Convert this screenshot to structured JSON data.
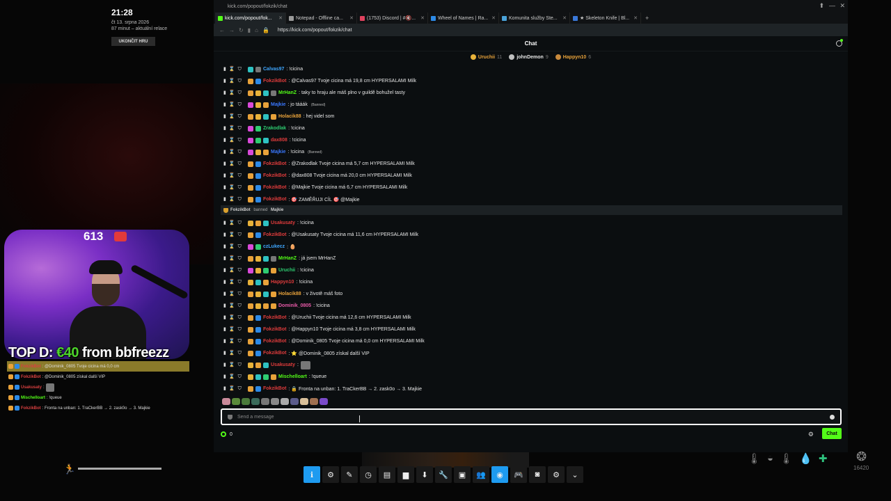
{
  "overlay": {
    "clock": "21:28",
    "date": "čt 13. srpna 2026",
    "session": "87 minut – aktuální relace",
    "end_button": "UKONČIT HRU",
    "sub_count": "613",
    "top_donation_prefix": "TOP D: ",
    "top_donation_amount": "€40",
    "top_donation_suffix": " from bbfreezz",
    "chat": [
      {
        "user": "FokzikBot",
        "text": ": @Dominik_0805 Tvoje cicina má 0,0 cm",
        "color": "#d94040",
        "highlight": true
      },
      {
        "user": "FokzikBot",
        "text": ": @Dominik_0805 získal další VIP",
        "color": "#d94040",
        "highlight": false
      },
      {
        "user": "Usakusaty",
        "text": ":",
        "color": "#d94040",
        "highlight": false
      },
      {
        "user": "Mischelloart",
        "text": ": !queue",
        "color": "#53fc18",
        "highlight": false
      },
      {
        "user": "FokzikBot",
        "text": ": Fronta na unban: 1. TraCkerBB → 2. zask0o → 3. Majkie",
        "color": "#d94040",
        "highlight": false
      }
    ],
    "progress": 1.0
  },
  "browser": {
    "title": "kick.com/popout/fokzik/chat",
    "tabs": [
      {
        "label": "kick.com/popout/fok...",
        "color": "#53fc18",
        "active": true
      },
      {
        "label": "Notepad - Offline ca...",
        "color": "#9a9a9a",
        "active": false
      },
      {
        "label": "(1753) Discord | #🔇...",
        "color": "#e0425e",
        "active": false
      },
      {
        "label": "Wheel of Names | Ra...",
        "color": "#2d8ae6",
        "active": false
      },
      {
        "label": "Komunita služby Ste...",
        "color": "#4aa2d9",
        "active": false
      },
      {
        "label": "★ Skeleton Knife | Bl...",
        "color": "#3a78d8",
        "active": false
      }
    ],
    "new_tab": "+",
    "url": "https://kick.com/popout/fokzik/chat"
  },
  "chat": {
    "title": "Chat",
    "leaders": [
      {
        "name": "Uruchii",
        "count": "11",
        "color": "#e8a23a",
        "medal": "#e8b23a"
      },
      {
        "name": "johnDemon",
        "count": "9",
        "color": "#e6e6e6",
        "medal": "#c0c0c0"
      },
      {
        "name": "Happyn10",
        "count": "6",
        "color": "#e8a23a",
        "medal": "#c98a3c"
      }
    ],
    "notice": {
      "actor": "FokzikBot",
      "verb": " banned ",
      "target": "Majkie"
    },
    "messages_before": [
      {
        "user": "Calvas97",
        "text": ": !cicina",
        "color": "#3fa7ff",
        "badges": [
          "#2ec2c2",
          "#777"
        ]
      },
      {
        "user": "FokzikBot",
        "text": ": @Calvas97 Tvoje cicina má 19,8 cm HYPERSALAMI Milk",
        "color": "#e03c3c",
        "badges": [
          "#e8a23a",
          "#2d8ae6"
        ]
      },
      {
        "user": "MrHanZ",
        "text": ": taky to hraju ale máš plno v guildě bohužel tasty",
        "color": "#53fc18",
        "badges": [
          "#e8a23a",
          "#e8b23a",
          "#2ec2c2",
          "#777"
        ]
      },
      {
        "user": "Majkie",
        "text": ": jo tááák",
        "color": "#3a78ff",
        "badges": [
          "#d94ad9",
          "#e8b23a",
          "#e8a23a"
        ],
        "banned": true
      },
      {
        "user": "Holacik88",
        "text": ": hej videl som",
        "color": "#e8a23a",
        "badges": [
          "#e8a23a",
          "#e8b23a",
          "#2ec2c2",
          "#e8a23a"
        ]
      },
      {
        "user": "Zrakodlak",
        "text": ": !cicina",
        "color": "#2ecc71",
        "badges": [
          "#d94ad9",
          "#2ecc71"
        ]
      },
      {
        "user": "dax808",
        "text": ": !cicina",
        "color": "#e03c3c",
        "badges": [
          "#d94ad9",
          "#2ecc71",
          "#2ec2c2"
        ]
      },
      {
        "user": "Majkie",
        "text": ": !cicina",
        "color": "#3a78ff",
        "badges": [
          "#d94ad9",
          "#e8b23a",
          "#e8a23a"
        ],
        "banned": true
      },
      {
        "user": "FokzikBot",
        "text": ": @Zrakodlak Tvoje cicina má 5,7 cm HYPERSALAMI Milk",
        "color": "#e03c3c",
        "badges": [
          "#e8a23a",
          "#2d8ae6"
        ]
      },
      {
        "user": "FokzikBot",
        "text": ": @dax808 Tvoje cicina má 20,0 cm HYPERSALAMI Milk",
        "color": "#e03c3c",
        "badges": [
          "#e8a23a",
          "#2d8ae6"
        ]
      },
      {
        "user": "FokzikBot",
        "text": ": @Majkie Tvoje cicina má 6,7 cm HYPERSALAMI Milk",
        "color": "#e03c3c",
        "badges": [
          "#e8a23a",
          "#2d8ae6"
        ]
      },
      {
        "user": "FokzikBot",
        "text": ": 🎯 ZAMĚŘUJI CÍL 🎯 @Majkie",
        "color": "#e03c3c",
        "badges": [
          "#e8a23a",
          "#2d8ae6"
        ]
      }
    ],
    "messages_after": [
      {
        "user": "Usakusaty",
        "text": ": !cicina",
        "color": "#e03c3c",
        "badges": [
          "#e8b23a",
          "#e8a23a",
          "#2ec2c2"
        ]
      },
      {
        "user": "FokzikBot",
        "text": ": @Usakusaty Tvoje cicina má 11,6 cm HYPERSALAMI Milk",
        "color": "#e03c3c",
        "badges": [
          "#e8a23a",
          "#2d8ae6"
        ]
      },
      {
        "user": "czLukecz",
        "text": ": 🥚",
        "color": "#3fa7ff",
        "badges": [
          "#d94ad9",
          "#2ecc71"
        ]
      },
      {
        "user": "MrHanZ",
        "text": ": já jsem MrHanZ",
        "color": "#53fc18",
        "badges": [
          "#e8a23a",
          "#e8b23a",
          "#2ec2c2",
          "#777"
        ]
      },
      {
        "user": "Uruchii",
        "text": ": !cicina",
        "color": "#2ecc71",
        "badges": [
          "#d94ad9",
          "#e8b23a",
          "#2ecc71",
          "#e8a23a"
        ]
      },
      {
        "user": "Happyn10",
        "text": ": !cicina",
        "color": "#e03c3c",
        "badges": [
          "#e8b23a",
          "#2ec2c2",
          "#e8a23a"
        ]
      },
      {
        "user": "Holacik88",
        "text": ": v životě máš foto",
        "color": "#e8a23a",
        "badges": [
          "#e8a23a",
          "#e8b23a",
          "#2ec2c2",
          "#e8a23a"
        ]
      },
      {
        "user": "Dominik_0805",
        "text": ": !cicina",
        "color": "#e85aa8",
        "badges": [
          "#e8a23a",
          "#e8b23a",
          "#e8a23a",
          "#e8a23a"
        ]
      },
      {
        "user": "FokzikBot",
        "text": ": @Uruchii Tvoje cicina má 12,6 cm HYPERSALAMI Milk",
        "color": "#e03c3c",
        "badges": [
          "#e8a23a",
          "#2d8ae6"
        ]
      },
      {
        "user": "FokzikBot",
        "text": ": @Happyn10 Tvoje cicina má 3,8 cm HYPERSALAMI Milk",
        "color": "#e03c3c",
        "badges": [
          "#e8a23a",
          "#2d8ae6"
        ]
      },
      {
        "user": "FokzikBot",
        "text": ": @Dominik_0805 Tvoje cicina má 0,0 cm HYPERSALAMI Milk",
        "color": "#e03c3c",
        "badges": [
          "#e8a23a",
          "#2d8ae6"
        ]
      },
      {
        "user": "FokzikBot",
        "text": ": ⭐ @Dominik_0805 získal další VIP",
        "color": "#e03c3c",
        "badges": [
          "#e8a23a",
          "#2d8ae6"
        ]
      },
      {
        "user": "Usakusaty",
        "text": ":",
        "color": "#e03c3c",
        "badges": [
          "#e8b23a",
          "#e8a23a",
          "#2ec2c2"
        ]
      },
      {
        "user": "Mischelloart",
        "text": ": !queue",
        "color": "#53fc18",
        "badges": [
          "#e8b23a",
          "#2ec2c2",
          "#2ecc71",
          "#e8a23a"
        ]
      },
      {
        "user": "FokzikBot",
        "text": ": 🔒 Fronta na unban: 1. TraCkerBB → 2. zask0o → 3. Majkie",
        "color": "#e03c3c",
        "badges": [
          "#e8a23a",
          "#2d8ae6"
        ]
      }
    ],
    "banned_label": "(Banned)",
    "input_placeholder": "Send a message",
    "points": "0",
    "send_label": "Chat"
  },
  "hud": {
    "score": "16420"
  }
}
